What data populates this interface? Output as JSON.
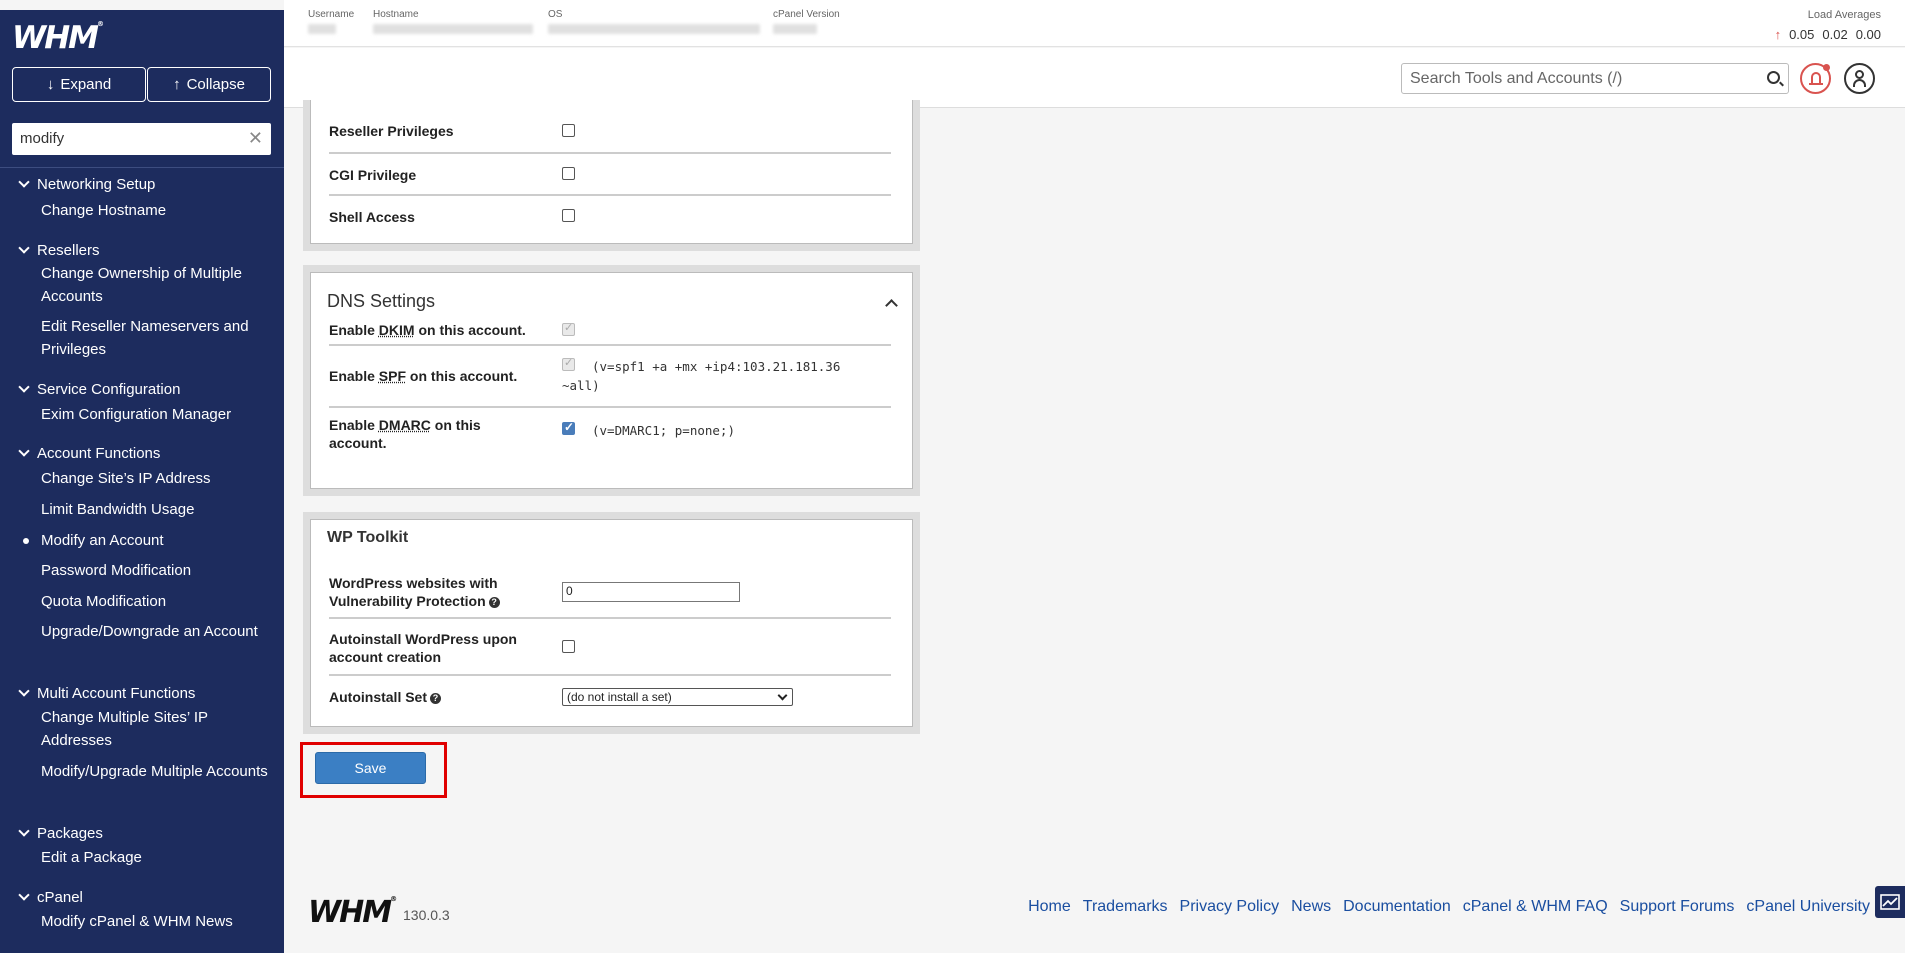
{
  "sidebar": {
    "logo": "WHM",
    "expand_label": "Expand",
    "collapse_label": "Collapse",
    "search_value": "modify",
    "categories": [
      {
        "label": "Networking Setup"
      },
      {
        "label": "Resellers"
      },
      {
        "label": "Service Configuration"
      },
      {
        "label": "Account Functions"
      },
      {
        "label": "Multi Account Functions"
      },
      {
        "label": "Packages"
      },
      {
        "label": "cPanel"
      }
    ],
    "items": [
      {
        "label": "Change Hostname"
      },
      {
        "label": "Change Ownership of Multiple Accounts"
      },
      {
        "label": "Edit Reseller Nameservers and Privileges"
      },
      {
        "label": "Exim Configuration Manager"
      },
      {
        "label": "Change Site’s IP Address"
      },
      {
        "label": "Limit Bandwidth Usage"
      },
      {
        "label": "Modify an Account"
      },
      {
        "label": "Password Modification"
      },
      {
        "label": "Quota Modification"
      },
      {
        "label": "Upgrade/Downgrade an Account"
      },
      {
        "label": "Change Multiple Sites’ IP Addresses"
      },
      {
        "label": "Modify/Upgrade Multiple Accounts"
      },
      {
        "label": "Edit a Package"
      },
      {
        "label": "Modify cPanel & WHM News"
      }
    ]
  },
  "topbar": {
    "username_label": "Username",
    "hostname_label": "Hostname",
    "os_label": "OS",
    "cpanel_version_label": "cPanel Version",
    "load_label": "Load Averages",
    "load_values": [
      "0.05",
      "0.02",
      "0.00"
    ]
  },
  "header": {
    "search_placeholder": "Search Tools and Accounts (/)"
  },
  "privileges": {
    "rows": [
      {
        "label": "Reseller Privileges",
        "checked": false
      },
      {
        "label": "CGI Privilege",
        "checked": false
      },
      {
        "label": "Shell Access",
        "checked": false
      }
    ]
  },
  "dns": {
    "title": "DNS Settings",
    "dkim": {
      "prefix": "Enable ",
      "abbr": "DKIM",
      "suffix": " on this account."
    },
    "spf": {
      "prefix": "Enable ",
      "abbr": "SPF",
      "suffix": " on this account.",
      "record": "(v=spf1 +a +mx +ip4:103.21.181.36",
      "record2": "~all)"
    },
    "dmarc": {
      "prefix": "Enable ",
      "abbr": "DMARC",
      "suffix": " on this",
      "suffix2": "account.",
      "record": "(v=DMARC1; p=none;)"
    }
  },
  "wp": {
    "title": "WP Toolkit",
    "vuln_label_1": "WordPress websites with",
    "vuln_label_2": "Vulnerability Protection",
    "vuln_value": "0",
    "autoinstall_label_1": "Autoinstall WordPress upon",
    "autoinstall_label_2": "account creation",
    "set_label": "Autoinstall Set",
    "set_value": "(do not install a set)"
  },
  "actions": {
    "save_label": "Save"
  },
  "footer": {
    "logo": "WHM",
    "version": "130.0.3",
    "links": [
      "Home",
      "Trademarks",
      "Privacy Policy",
      "News",
      "Documentation",
      "cPanel & WHM FAQ",
      "Support Forums",
      "cPanel University"
    ]
  }
}
